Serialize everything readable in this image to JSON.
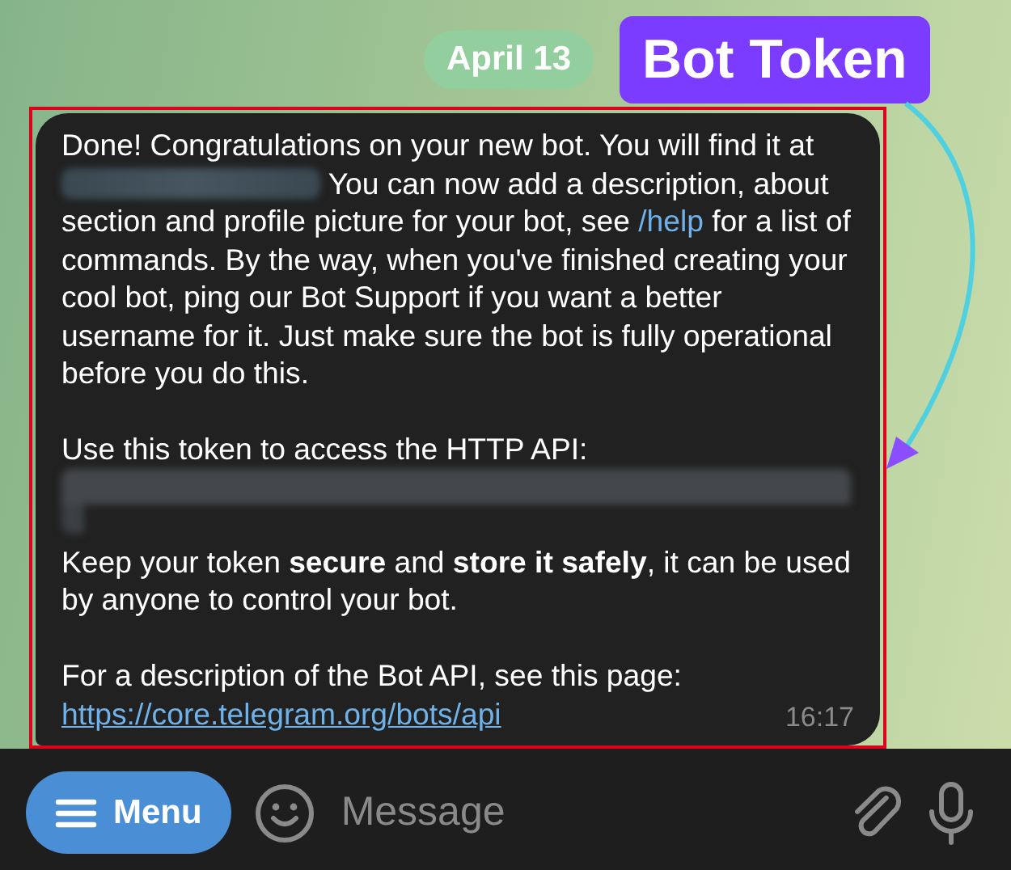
{
  "date_pill": "April 13",
  "annotation": {
    "label": "Bot Token"
  },
  "message": {
    "paragraphs": [
      {
        "segments": [
          {
            "kind": "text",
            "text": "Done! Congratulations on your new bot. You will find it at"
          },
          {
            "kind": "redacted"
          },
          {
            "kind": "text",
            "text": "You can now add a description, about section and profile picture for your bot, see"
          },
          {
            "kind": "link",
            "text": "/help"
          },
          {
            "kind": "text",
            "text": "for a list of commands. By the way, when you've finished creating your cool bot, ping our Bot Support if you want a better username for it. Just make sure the bot is fully operational before you do this."
          }
        ]
      },
      {
        "segments": [
          {
            "kind": "text",
            "text": "Use this token to access the HTTP API:"
          },
          {
            "kind": "redacted_block"
          }
        ]
      },
      {
        "segments": [
          {
            "kind": "text",
            "text": "Keep your token **secure** and **store it safely**, it can be used by anyone to control your bot."
          }
        ]
      },
      {
        "segments": [
          {
            "kind": "text",
            "text": "For a description of the Bot API, see this page:"
          },
          {
            "kind": "link",
            "text": "https://core.telegram.org/bots/api"
          }
        ]
      }
    ],
    "time": "16:17"
  },
  "composer": {
    "menu_button": "Menu",
    "placeholder": "Message"
  }
}
